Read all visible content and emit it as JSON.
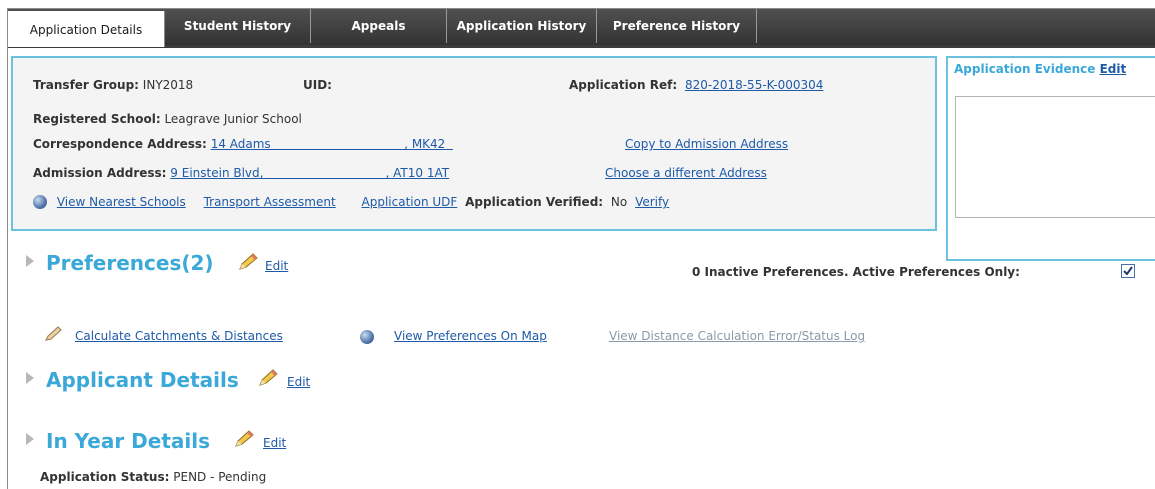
{
  "tabs": [
    {
      "label": "Application Details",
      "active": true
    },
    {
      "label": "Student History",
      "active": false
    },
    {
      "label": "Appeals",
      "active": false
    },
    {
      "label": "Application History",
      "active": false
    },
    {
      "label": "Preference History",
      "active": false
    }
  ],
  "details": {
    "transfer_group_label": "Transfer Group:",
    "transfer_group_value": "INY2018",
    "uid_label": "UID:",
    "app_ref_label": "Application Ref:",
    "app_ref_value": "820-2018-55-K-000304",
    "registered_school_label": "Registered School:",
    "registered_school_value": "Leagrave Junior School",
    "corr_address_label": "Correspondence Address:",
    "corr_address_value": "14 Adams                                   , MK42  ",
    "copy_to_admission": "Copy to Admission Address",
    "admission_address_label": "Admission Address:",
    "admission_address_value": "9 Einstein Blvd,                                , AT10 1AT",
    "choose_address": "Choose a different Address",
    "view_nearest": "View Nearest Schools",
    "transport_assessment": "Transport Assessment",
    "application_udf": "Application UDF",
    "verified_label": "Application Verified:",
    "verified_value": "No",
    "verify_link": "Verify"
  },
  "evidence": {
    "title": "Application Evidence",
    "edit": "Edit"
  },
  "preferences": {
    "title": "Preferences",
    "count": "(2)",
    "edit": "Edit",
    "inactive_text": "0 Inactive Preferences.  Active Preferences Only:",
    "active_only_checked": true,
    "calc_catchments": "Calculate Catchments & Distances",
    "view_on_map": "View Preferences On Map",
    "error_log": "View Distance Calculation Error/Status Log"
  },
  "applicant": {
    "title": "Applicant Details",
    "edit": "Edit"
  },
  "in_year": {
    "title": "In Year Details",
    "edit": "Edit"
  },
  "status": {
    "label": "Application Status:",
    "value": "PEND - Pending"
  },
  "colors": {
    "accent": "#3aa8d8",
    "link": "#1e5aa8",
    "tab_bar": "#3c3c3c"
  }
}
